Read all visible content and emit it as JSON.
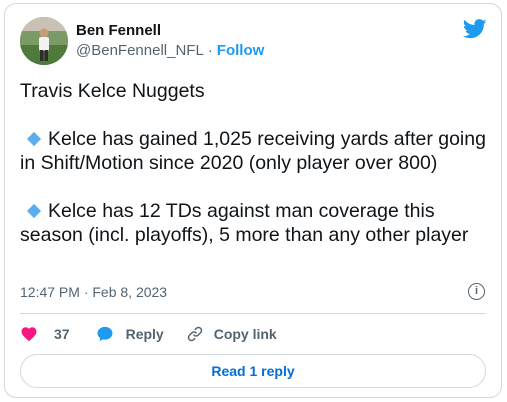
{
  "tweet": {
    "author": {
      "display_name": "Ben Fennell",
      "handle": "@BenFennell_NFL",
      "separator": "·",
      "follow_label": "Follow"
    },
    "text": {
      "line1": "Travis Kelce Nuggets",
      "para2": "Kelce has gained 1,025 receiving yards after going in Shift/Motion since 2020 (only player over 800)",
      "para3": "Kelce has 12 TDs against man coverage this season (incl. playoffs), 5 more than any other player"
    },
    "timestamp": "12:47 PM · Feb 8, 2023",
    "actions": {
      "likes_count": "37",
      "reply_label": "Reply",
      "copy_label": "Copy link"
    },
    "read_replies_label": "Read 1 reply",
    "info_glyph": "i"
  },
  "colors": {
    "accent": "#1d9bf0",
    "heart": "#f91880",
    "link_button": "#006fd6",
    "muted": "#536471",
    "border": "#cfd9de"
  },
  "icons": [
    "twitter-bird-icon",
    "heart-icon",
    "reply-bubble-icon",
    "link-icon",
    "info-icon",
    "diamond-bullet-icon"
  ]
}
